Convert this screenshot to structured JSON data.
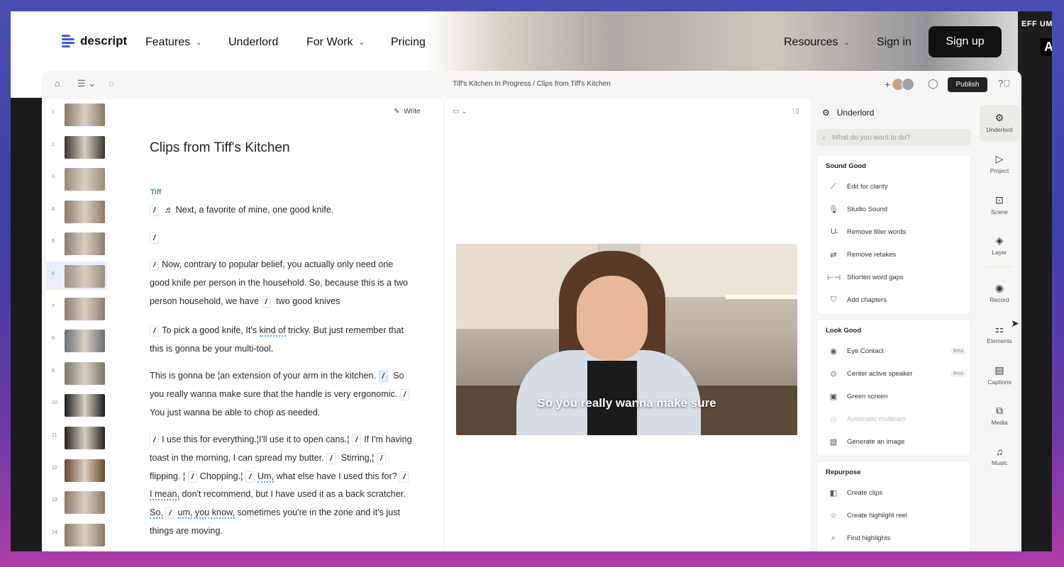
{
  "nav": {
    "logo": "descript",
    "items": [
      "Features",
      "Underlord",
      "For Work",
      "Pricing"
    ],
    "right_items": [
      "Resources",
      "Sign in"
    ],
    "signup": "Sign up",
    "bg_tag_1": "EFF UMB",
    "bg_tag_2": "Ar"
  },
  "app": {
    "breadcrumb": "Tiff's Kitchen In Progress  /  Clips from Tiff's Kitchen",
    "publish": "Publish",
    "write": "Write",
    "doc_title": "Clips from Tiff's Kitchen",
    "speaker": "Tiff",
    "thumbs": [
      "1",
      "2",
      "3",
      "4",
      "5",
      "6",
      "7",
      "8",
      "9",
      "10",
      "11",
      "12",
      "13",
      "14"
    ],
    "selected_thumb": "6",
    "transcript": {
      "p1": "Next, a favorite of mine,  one good knife.",
      "p3a": "Now, contrary to popular belief, you actually only need one good knife per person in the household. So, because this is a two person household, we have",
      "p3b": " two good knives",
      "p4a": "To pick a good knife, It's  ",
      "p4u": "kind of",
      "p4b": " tricky. But just remember that this is gonna be your multi-tool.",
      "p5a": "This is gonna be ¦an extension of your arm in the kitchen.",
      "p5b": "So you really wanna make sure that the handle is very ergonomic.",
      "p5c": "You just wanna be able to chop as needed.",
      "p6a": "I use this for everything.¦I'll use it to open cans.¦",
      "p6b": "If I'm having toast in the morning, I can spread my butter.",
      "p6c": "Stirring,¦",
      "p6d": "flipping. ¦",
      "p6e": "Chopping.¦",
      "p6f": "Um,",
      "p6g": " what else have I used this for?",
      "p6h": "I mean,",
      "p6i": " don't recommend, but I have used it as a back scratcher. ",
      "p6j": "So,",
      "p6k": "um, you know,",
      "p6l": " sometimes you're in the zone and it's just things are moving."
    },
    "video_caption": "So you really wanna make sure"
  },
  "panel": {
    "title": "Underlord",
    "search_placeholder": "What do you want to do?",
    "sound_good": {
      "title": "Sound Good",
      "items": [
        {
          "label": "Edit for clarity",
          "icon": "wand-icon"
        },
        {
          "label": "Studio Sound",
          "icon": "mic-sparkle-icon"
        },
        {
          "label": "Remove filler words",
          "icon": "strikethrough-icon"
        },
        {
          "label": "Remove retakes",
          "icon": "repeat-icon"
        },
        {
          "label": "Shorten word gaps",
          "icon": "gap-icon"
        },
        {
          "label": "Add chapters",
          "icon": "bookmark-icon"
        }
      ]
    },
    "look_good": {
      "title": "Look Good",
      "items": [
        {
          "label": "Eye Contact",
          "icon": "eye-icon",
          "badge": "Beta"
        },
        {
          "label": "Center active speaker",
          "icon": "center-speaker-icon",
          "badge": "Beta"
        },
        {
          "label": "Green screen",
          "icon": "green-screen-icon"
        },
        {
          "label": "Automatic multicam",
          "icon": "multicam-icon"
        },
        {
          "label": "Generate an image",
          "icon": "image-sparkle-icon"
        }
      ]
    },
    "repurpose": {
      "title": "Repurpose",
      "items": [
        {
          "label": "Create clips",
          "icon": "clips-icon"
        },
        {
          "label": "Create highlight reel",
          "icon": "star-icon"
        },
        {
          "label": "Find highlights",
          "icon": "search-icon"
        }
      ]
    }
  },
  "rail": [
    "Underlord",
    "Project",
    "Scene",
    "Layer",
    "Record",
    "Elements",
    "Captions",
    "Media",
    "Music"
  ]
}
